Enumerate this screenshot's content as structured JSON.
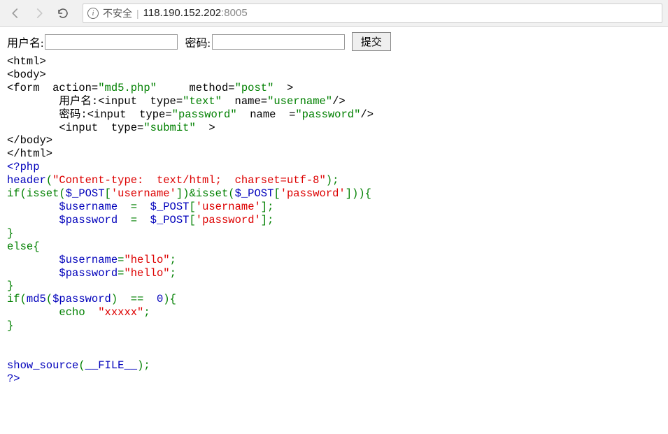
{
  "browser": {
    "security_label": "不安全",
    "url_host": "118.190.152.202",
    "url_port": ":8005"
  },
  "form": {
    "username_label": "用户名:",
    "password_label": "密码:",
    "submit_label": "提交"
  },
  "src": {
    "l1": "<html>",
    "l2": "<body>",
    "l3a": "<form  action=",
    "l3b": "\"md5.php\"",
    "l3c": "     method=",
    "l3d": "\"post\"",
    "l3e": "  >",
    "l4a": "        用户名:<input  type=",
    "l4b": "\"text\"",
    "l4c": "  name=",
    "l4d": "\"username\"",
    "l4e": "/>",
    "l5a": "        密码:<input  type=",
    "l5b": "\"password\"",
    "l5c": "  name  =",
    "l5d": "\"password\"",
    "l5e": "/>",
    "l6a": "        <input  type=",
    "l6b": "\"submit\"",
    "l6c": "  >",
    "l7": "</body>",
    "l8": "</html>",
    "php_open": "<?php",
    "hdr_fn": "header",
    "hdr_p1": "(",
    "hdr_str": "\"Content-type:  text/html;  charset=utf-8\"",
    "hdr_p2": ");",
    "if1a": "if(isset(",
    "if1b": "$_POST",
    "if1c": "[",
    "if1d": "'username'",
    "if1e": "])&isset(",
    "if1f": "$_POST",
    "if1g": "[",
    "if1h": "'password'",
    "if1i": "])){",
    "as1a": "        ",
    "as1b": "$username  ",
    "as1c": "=  ",
    "as1d": "$_POST",
    "as1e": "[",
    "as1f": "'username'",
    "as1g": "];",
    "as2a": "        ",
    "as2b": "$password  ",
    "as2c": "=  ",
    "as2d": "$_POST",
    "as2e": "[",
    "as2f": "'password'",
    "as2g": "];",
    "cb1": "}",
    "else_kw": "else{",
    "el1a": "        ",
    "el1b": "$username",
    "el1c": "=",
    "el1d": "\"hello\"",
    "el1e": ";",
    "el2a": "        ",
    "el2b": "$password",
    "el2c": "=",
    "el2d": "\"hello\"",
    "el2e": ";",
    "cb2": "}",
    "if2a": "if(",
    "if2b": "md5",
    "if2c": "(",
    "if2d": "$password",
    "if2e": ")  ==  ",
    "if2f": "0",
    "if2g": "){",
    "echo_a": "        echo  ",
    "echo_b": "\"xxxxx\"",
    "echo_c": ";",
    "cb3": "}",
    "blank": "",
    "ss1a": "show_source",
    "ss1b": "(",
    "ss1c": "__FILE__",
    "ss1d": ");",
    "php_close": "?>"
  }
}
